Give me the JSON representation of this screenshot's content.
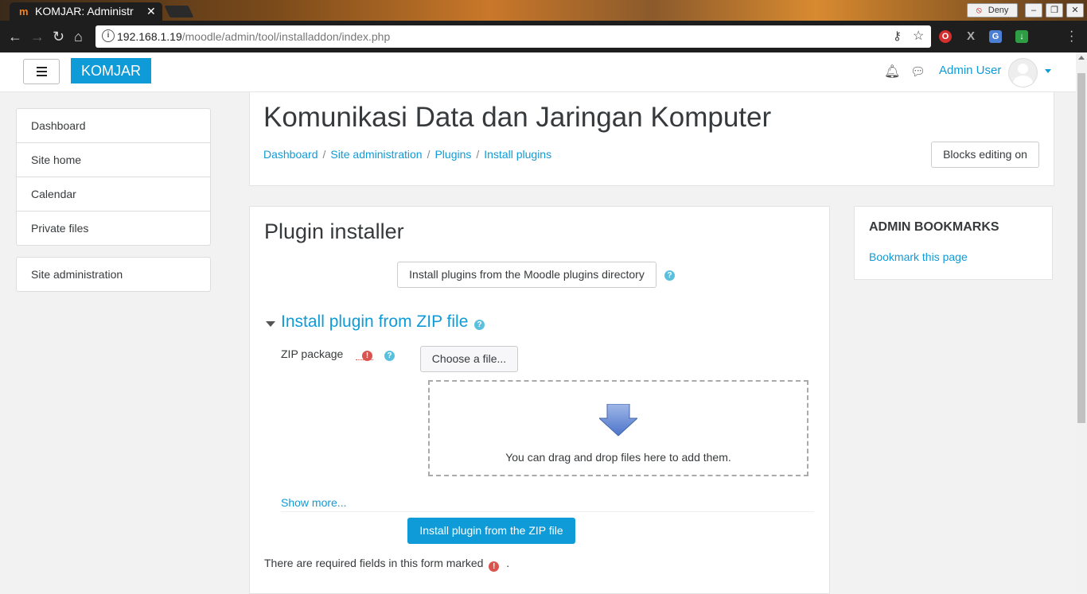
{
  "browser": {
    "tab_title": "KOMJAR: Administr",
    "tab_favicon": "m",
    "url_host": "192.168.1.19",
    "url_path": "/moodle/admin/tool/installaddon/index.php",
    "deny_label": "Deny",
    "extensions": [
      "opera-icon",
      "x-icon",
      "translate-icon",
      "download-icon"
    ]
  },
  "navbar": {
    "brand": "KOMJAR",
    "user_name": "Admin User"
  },
  "drawer": {
    "items": [
      "Dashboard",
      "Site home",
      "Calendar",
      "Private files"
    ],
    "admin_item": "Site administration"
  },
  "header": {
    "title": "Komunikasi Data dan Jaringan Komputer",
    "breadcrumb": [
      "Dashboard",
      "Site administration",
      "Plugins",
      "Install plugins"
    ],
    "breadcrumb_separator": "/",
    "blocks_button": "Blocks editing on"
  },
  "main": {
    "title": "Plugin installer",
    "directory_button": "Install plugins from the Moodle plugins directory",
    "section_title": "Install plugin from ZIP file",
    "zip_label": "ZIP package",
    "choose_button": "Choose a file...",
    "dropzone_text": "You can drag and drop files here to add them.",
    "show_more": "Show more...",
    "install_button": "Install plugin from the ZIP file",
    "required_note": "There are required fields in this form marked",
    "required_note_end": "."
  },
  "block": {
    "title": "ADMIN BOOKMARKS",
    "link": "Bookmark this page"
  },
  "colors": {
    "accent": "#0f9bd7",
    "required": "#d9534f",
    "help": "#5bc0de"
  }
}
